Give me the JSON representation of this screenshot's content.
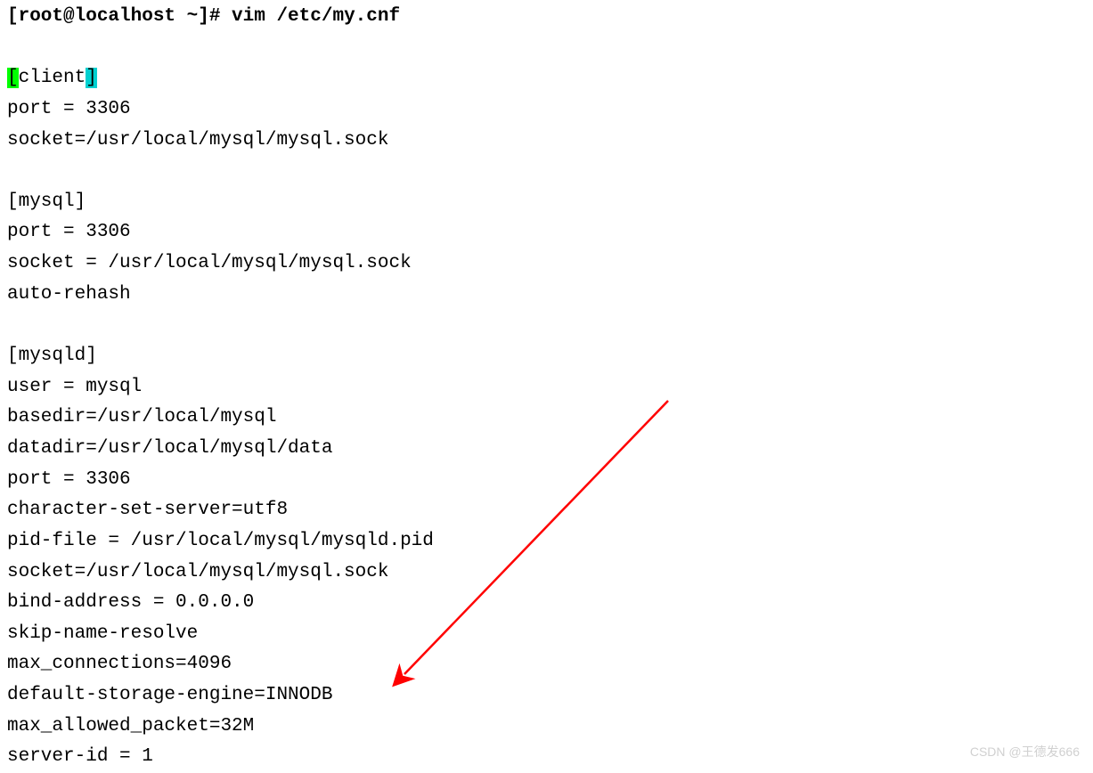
{
  "prompt": {
    "text": "[root@localhost ~]# ",
    "command": "vim /etc/my.cnf"
  },
  "section_client": {
    "open": "[",
    "name": "client",
    "close": "]"
  },
  "config": {
    "client_port": "port = 3306",
    "client_socket": "socket=/usr/local/mysql/mysql.sock",
    "mysql_header": "[mysql]",
    "mysql_port": "port = 3306",
    "mysql_socket": "socket = /usr/local/mysql/mysql.sock",
    "mysql_autorehash": "auto-rehash",
    "mysqld_header": "[mysqld]",
    "mysqld_user": "user = mysql",
    "mysqld_basedir": "basedir=/usr/local/mysql",
    "mysqld_datadir": "datadir=/usr/local/mysql/data",
    "mysqld_port": "port = 3306",
    "mysqld_charset": "character-set-server=utf8",
    "mysqld_pidfile": "pid-file = /usr/local/mysql/mysqld.pid",
    "mysqld_socket": "socket=/usr/local/mysql/mysql.sock",
    "mysqld_bind": "bind-address = 0.0.0.0",
    "mysqld_skip": "skip-name-resolve",
    "mysqld_maxconn": "max_connections=4096",
    "mysqld_engine": "default-storage-engine=INNODB",
    "mysqld_packet": "max_allowed_packet=32M",
    "mysqld_serverid": "server-id = 1"
  },
  "watermark": "CSDN @王德发666"
}
